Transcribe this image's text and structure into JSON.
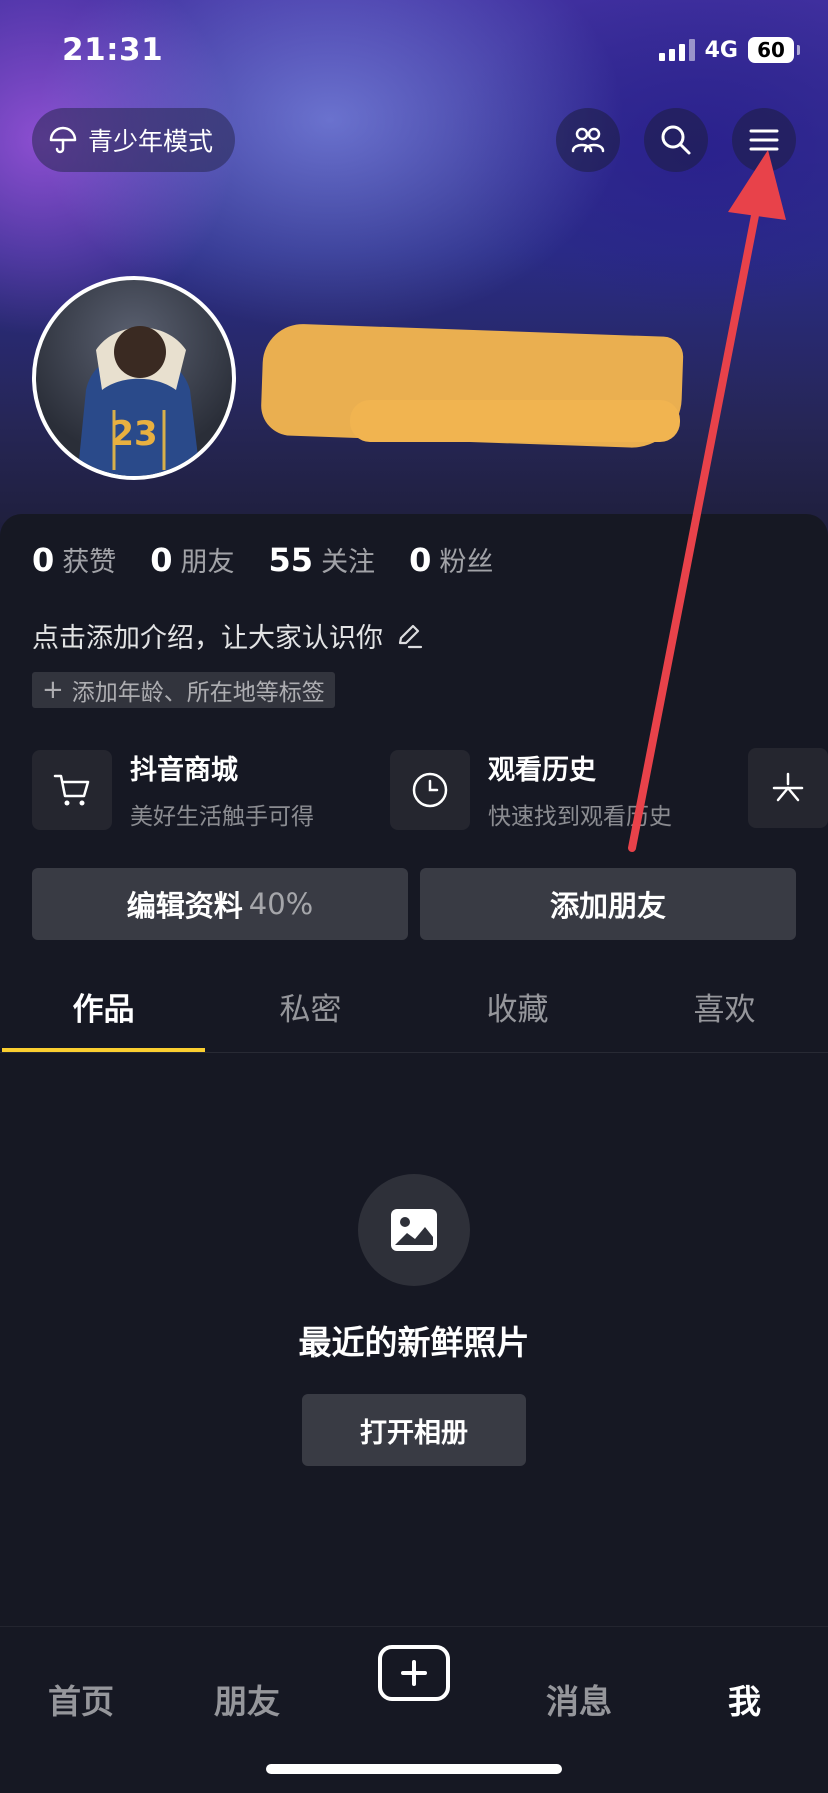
{
  "status_bar": {
    "time": "21:31",
    "network": "4G",
    "battery": "60"
  },
  "header": {
    "teen_mode_label": "青少年模式",
    "friends_icon": "people-icon",
    "search_icon": "search-icon",
    "menu_icon": "hamburger-menu-icon"
  },
  "profile": {
    "stats": [
      {
        "value": "0",
        "label": "获赞"
      },
      {
        "value": "0",
        "label": "朋友"
      },
      {
        "value": "55",
        "label": "关注"
      },
      {
        "value": "0",
        "label": "粉丝"
      }
    ],
    "bio_placeholder": "点击添加介绍，让大家认识你",
    "tag_prompt": "添加年龄、所在地等标签"
  },
  "services": [
    {
      "title": "抖音商城",
      "subtitle": "美好生活触手可得",
      "icon": "cart-icon"
    },
    {
      "title": "观看历史",
      "subtitle": "快速找到观看历史",
      "icon": "clock-icon"
    }
  ],
  "actions": {
    "edit_label": "编辑资料",
    "edit_percent": "40%",
    "add_friend_label": "添加朋友"
  },
  "tabs": [
    {
      "label": "作品",
      "active": true
    },
    {
      "label": "私密",
      "active": false
    },
    {
      "label": "收藏",
      "active": false
    },
    {
      "label": "喜欢",
      "active": false
    }
  ],
  "empty_state": {
    "title": "最近的新鲜照片",
    "button": "打开相册",
    "icon": "photo-icon"
  },
  "bottom_nav": {
    "home": "首页",
    "friends": "朋友",
    "messages": "消息",
    "me": "我",
    "active": "我"
  },
  "annotation": {
    "arrow_color": "#e8424a"
  },
  "colors": {
    "accent": "#fbcf30",
    "background": "#161823",
    "button": "#393b44"
  }
}
